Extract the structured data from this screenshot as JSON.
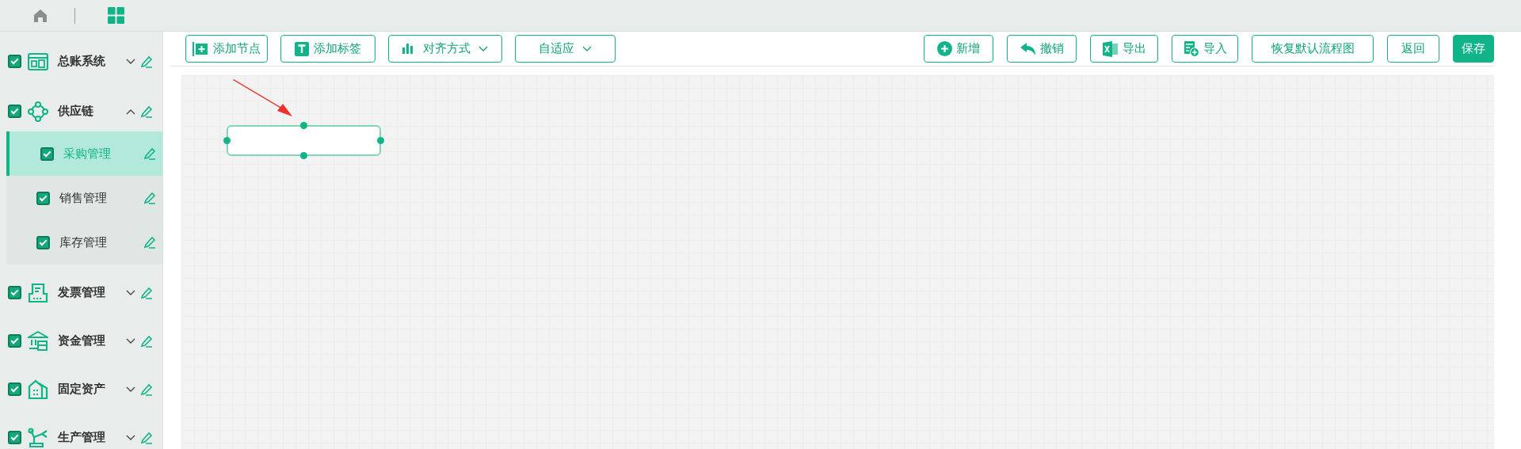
{
  "sidebar": {
    "items": [
      {
        "label": "总账系统",
        "checked": true,
        "expanded": false
      },
      {
        "label": "供应链",
        "checked": true,
        "expanded": true,
        "children": [
          {
            "label": "采购管理",
            "checked": true,
            "selected": true
          },
          {
            "label": "销售管理",
            "checked": true,
            "selected": false
          },
          {
            "label": "库存管理",
            "checked": true,
            "selected": false
          }
        ]
      },
      {
        "label": "发票管理",
        "checked": true,
        "expanded": false
      },
      {
        "label": "资金管理",
        "checked": true,
        "expanded": false
      },
      {
        "label": "固定资产",
        "checked": true,
        "expanded": false
      },
      {
        "label": "生产管理",
        "checked": true,
        "expanded": false
      }
    ]
  },
  "toolbar": {
    "left": [
      {
        "label": "添加节点",
        "dropdown": false
      },
      {
        "label": "添加标签",
        "dropdown": false
      },
      {
        "label": "对齐方式",
        "dropdown": true
      },
      {
        "label": "自适应",
        "dropdown": true
      }
    ],
    "right": [
      {
        "label": "新增",
        "primary": false
      },
      {
        "label": "撤销",
        "primary": false
      },
      {
        "label": "导出",
        "primary": false
      },
      {
        "label": "导入",
        "primary": false
      },
      {
        "label": "恢复默认流程图",
        "primary": false
      },
      {
        "label": "返回",
        "primary": false
      },
      {
        "label": "保存",
        "primary": true
      }
    ]
  }
}
